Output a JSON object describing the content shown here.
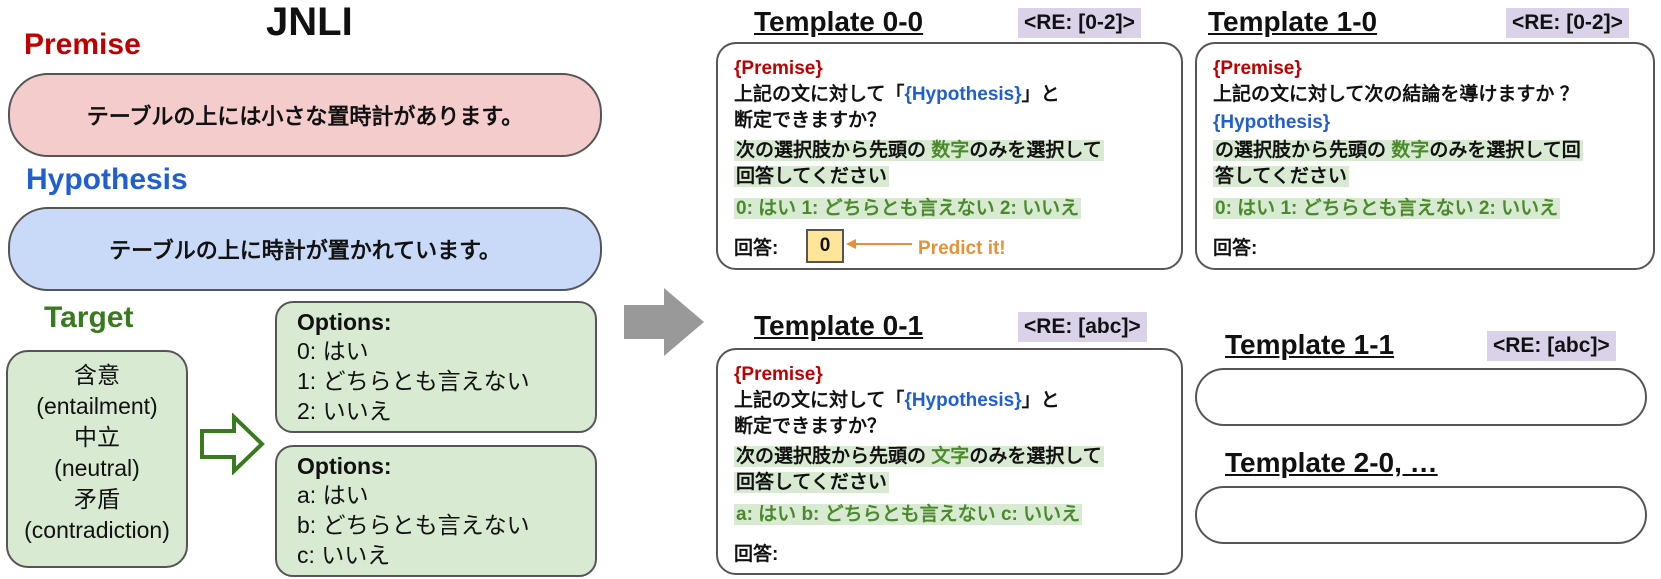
{
  "left": {
    "title": "JNLI",
    "premise_label": "Premise",
    "premise_text": "テーブルの上には小さな置時計があります。",
    "hypothesis_label": "Hypothesis",
    "hypothesis_text": "テーブルの上に時計が置かれています。",
    "target_label": "Target",
    "target_lines": [
      "含意",
      "(entailment)",
      "中立",
      "(neutral)",
      "矛盾",
      "(contradiction)"
    ],
    "options_numeric": {
      "title": "Options:",
      "items": [
        "0: はい",
        "1: どちらとも言えない",
        "2: いいえ"
      ]
    },
    "options_alpha": {
      "title": "Options:",
      "items": [
        "a: はい",
        "b: どちらとも言えない",
        "c: いいえ"
      ]
    }
  },
  "templates": {
    "t00": {
      "title": "Template 0-0",
      "re": "<RE: [0-2]>",
      "premise": "{Premise}",
      "q_pre": "上記の文に対して「",
      "hyp": "{Hypothesis}",
      "q_post": "」と",
      "q2": "断定できますか？",
      "inst_pre": "次の選択肢から先頭の",
      "inst_kw": "数字",
      "inst_post": "のみを選択して",
      "inst2": "回答してください",
      "choices": "0: はい 1: どちらとも言えない  2: いいえ",
      "answer": "回答:",
      "answer_value": "0",
      "predict": "Predict it!"
    },
    "t10": {
      "title": "Template 1-0",
      "re": "<RE: [0-2]>",
      "premise": "{Premise}",
      "q1": "上記の文に対して次の結論を導けますか ？",
      "hyp": "{Hypothesis}",
      "inst_pre": "の選択肢から先頭の",
      "inst_kw": "数字",
      "inst_post": "のみを選択して回",
      "inst2": "答してください",
      "choices": "0: はい 1: どちらとも言えない  2: いいえ",
      "answer": "回答:"
    },
    "t01": {
      "title": "Template 0-1",
      "re": "<RE: [abc]>",
      "premise": "{Premise}",
      "q_pre": "上記の文に対して「",
      "hyp": "{Hypothesis}",
      "q_post": "」と",
      "q2": "断定できますか？",
      "inst_pre": "次の選択肢から先頭の",
      "inst_kw": "文字",
      "inst_post": "のみを選択して",
      "inst2": "回答してください",
      "choices": "a: はい b: どちらとも言えない  c: いいえ",
      "answer": "回答:"
    },
    "t11": {
      "title": "Template 1-1",
      "re": "<RE: [abc]>"
    },
    "t20": {
      "title": "Template 2-0, …"
    }
  }
}
